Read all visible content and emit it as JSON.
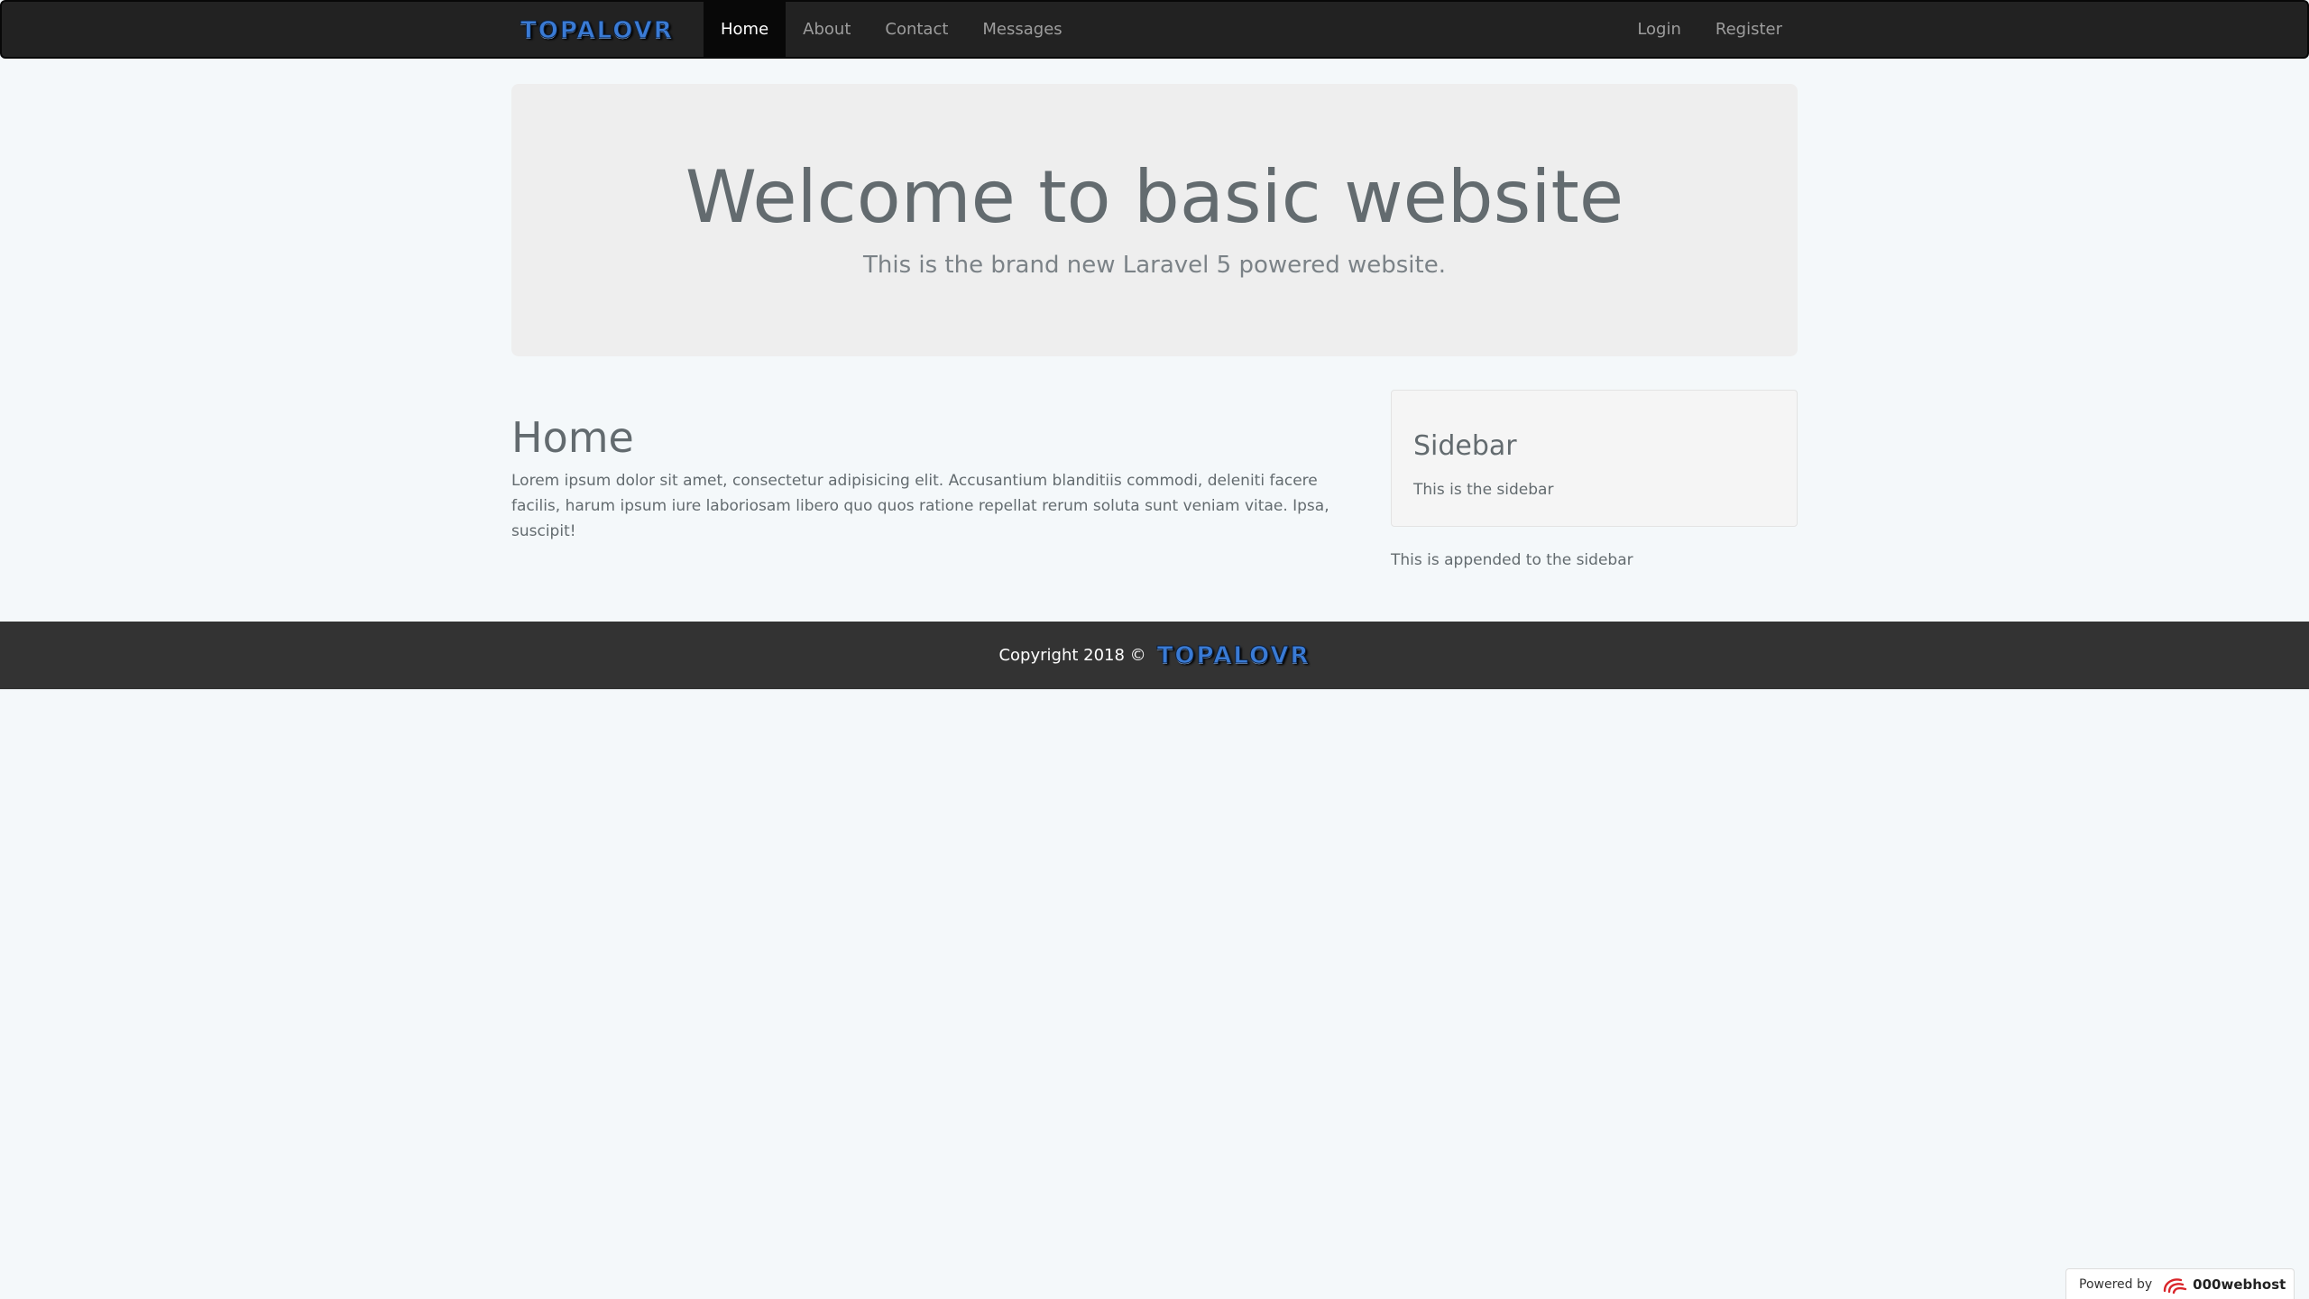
{
  "navbar": {
    "brand_logo_text": "TOPALOVR",
    "left_links": [
      "Home",
      "About",
      "Contact",
      "Messages"
    ],
    "active_link": "Home",
    "right_links": [
      "Login",
      "Register"
    ]
  },
  "jumbotron": {
    "title": "Welcome to basic website",
    "subtitle": "This is the brand new Laravel 5 powered website."
  },
  "main": {
    "heading": "Home",
    "body": "Lorem ipsum dolor sit amet, consectetur adipisicing elit. Accusantium blanditiis commodi, deleniti facere facilis, harum ipsum iure laboriosam libero quo quos ratione repellat rerum soluta sunt veniam vitae. Ipsa, suscipit!"
  },
  "sidebar": {
    "title": "Sidebar",
    "text": "This is the sidebar",
    "appended": "This is appended to the sidebar"
  },
  "footer": {
    "copyright": "Copyright 2018 ©",
    "logo_text": "TOPALOVR"
  },
  "badge": {
    "label": "Powered by",
    "host_name": "000webhost",
    "host_icon": "000webhost-swirl-icon"
  },
  "colors": {
    "navbar_bg": "#222222",
    "footer_bg": "#333333",
    "page_bg": "#f4f8fa",
    "logo_blue": "#3a7bd5",
    "badge_accent": "#d9252a"
  }
}
